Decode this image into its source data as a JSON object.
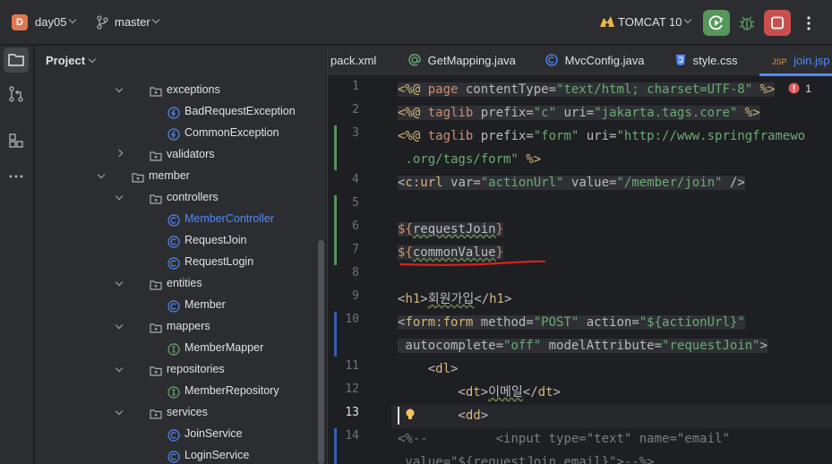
{
  "titlebar": {
    "project_badge": "D",
    "project_name": "day05",
    "branch": "master",
    "run_config": "TOMCAT 10"
  },
  "panel": {
    "title": "Project",
    "tree": [
      {
        "label": "exceptions",
        "type": "package",
        "expanded": true
      },
      {
        "label": "BadRequestException",
        "type": "exception"
      },
      {
        "label": "CommonException",
        "type": "exception"
      },
      {
        "label": "validators",
        "type": "package",
        "expanded": false
      },
      {
        "label": "member",
        "type": "package",
        "expanded": true
      },
      {
        "label": "controllers",
        "type": "package",
        "expanded": true
      },
      {
        "label": "MemberController",
        "type": "class",
        "selected": true
      },
      {
        "label": "RequestJoin",
        "type": "class"
      },
      {
        "label": "RequestLogin",
        "type": "class"
      },
      {
        "label": "entities",
        "type": "package",
        "expanded": true
      },
      {
        "label": "Member",
        "type": "class"
      },
      {
        "label": "mappers",
        "type": "package",
        "expanded": true
      },
      {
        "label": "MemberMapper",
        "type": "interface"
      },
      {
        "label": "repositories",
        "type": "package",
        "expanded": true
      },
      {
        "label": "MemberRepository",
        "type": "interface"
      },
      {
        "label": "services",
        "type": "package",
        "expanded": true
      },
      {
        "label": "JoinService",
        "type": "class"
      },
      {
        "label": "LoginService",
        "type": "class"
      }
    ]
  },
  "tabs": [
    {
      "label": "pack.xml",
      "icon": "xml-icon"
    },
    {
      "label": "GetMapping.java",
      "icon": "annotation-icon"
    },
    {
      "label": "MvcConfig.java",
      "icon": "class-icon"
    },
    {
      "label": "style.css",
      "icon": "css-icon"
    },
    {
      "label": "join.jsp",
      "icon": "jsp-icon",
      "active": true
    }
  ],
  "editor": {
    "error_count": "1",
    "line_numbers": [
      "1",
      "2",
      "3",
      "",
      "4",
      "5",
      "6",
      "7",
      "8",
      "9",
      "10",
      "",
      "11",
      "12",
      "13",
      "14"
    ],
    "current_line": "13",
    "code": {
      "l1": [
        "<%@ ",
        "page",
        " contentType=",
        "\"text/html; charset=UTF-8\"",
        " %>"
      ],
      "l2": [
        "<%@ ",
        "taglib",
        " prefix=",
        "\"c\"",
        " uri=",
        "\"jakarta.tags.core\"",
        " %>"
      ],
      "l3": [
        "<%@ ",
        "taglib",
        " prefix=",
        "\"form\"",
        " uri=",
        "\"http://www.springframewo"
      ],
      "l3b": [
        " .org/tags/form\"",
        " %>"
      ],
      "l4": [
        "<",
        "c:url",
        " var=",
        "\"actionUrl\"",
        " value=",
        "\"/member/join\"",
        " />"
      ],
      "l6": [
        "${",
        "requestJoin",
        "}"
      ],
      "l7": [
        "${",
        "commonValue",
        "}"
      ],
      "l9": [
        "<",
        "h1",
        ">",
        "회원가입",
        "</",
        "h1",
        ">"
      ],
      "l10": [
        "<",
        "form:form",
        " method=",
        "\"POST\"",
        " action=",
        "\"${actionUrl}\""
      ],
      "l10b": [
        " autocomplete=",
        "\"off\"",
        " modelAttribute=",
        "\"requestJoin\"",
        ">"
      ],
      "l11": [
        "    <",
        "dl",
        ">"
      ],
      "l12": [
        "        <",
        "dt",
        ">",
        "이메일",
        "</",
        "dt",
        ">"
      ],
      "l13": [
        "        <",
        "dd",
        ">"
      ],
      "l14": [
        "<%--",
        "     ",
        "    <input type=\"text\" name=\"email\""
      ],
      "l14b": [
        " value=\"${requestJoin.email}\">--%>"
      ]
    }
  }
}
